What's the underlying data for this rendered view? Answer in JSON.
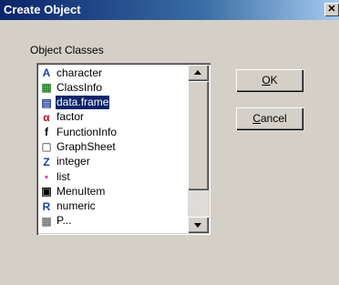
{
  "window": {
    "title": "Create Object",
    "close_glyph": "✕"
  },
  "group_label": "Object Classes",
  "list": {
    "items": [
      {
        "label": "character",
        "icon": "character-a-icon",
        "glyph": "A",
        "color": "#1f3fa0",
        "bg": "#ffffff"
      },
      {
        "label": "ClassInfo",
        "icon": "classinfo-icon",
        "glyph": "▦",
        "color": "#2e8b2e",
        "bg": "#ffffff"
      },
      {
        "label": "data.frame",
        "icon": "data-frame-icon",
        "glyph": "▤",
        "color": "#1f3fa0",
        "bg": "#ffffff",
        "selected": true
      },
      {
        "label": "factor",
        "icon": "factor-icon",
        "glyph": "α",
        "color": "#c01010",
        "bg": "#ffffff"
      },
      {
        "label": "FunctionInfo",
        "icon": "functioninfo-icon",
        "glyph": "f",
        "color": "#000000",
        "bg": "#ffffff"
      },
      {
        "label": "GraphSheet",
        "icon": "graphsheet-icon",
        "glyph": "▢",
        "color": "#808080",
        "bg": "#ffffff"
      },
      {
        "label": "integer",
        "icon": "integer-z-icon",
        "glyph": "Z",
        "color": "#1f3fa0",
        "bg": "#ffffff"
      },
      {
        "label": "list",
        "icon": "list-icon",
        "glyph": "▪",
        "color": "#d040d0",
        "bg": "#ffffff"
      },
      {
        "label": "MenuItem",
        "icon": "menuitem-icon",
        "glyph": "▣",
        "color": "#000000",
        "bg": "#ffffff"
      },
      {
        "label": "numeric",
        "icon": "numeric-r-icon",
        "glyph": "R",
        "color": "#1f3fa0",
        "bg": "#ffffff"
      },
      {
        "label": "P...",
        "icon": "partial-item-icon",
        "glyph": "▦",
        "color": "#808080",
        "bg": "#ffffff"
      }
    ]
  },
  "buttons": {
    "ok": {
      "mnemonic": "O",
      "rest": "K"
    },
    "cancel": {
      "mnemonic": "C",
      "rest": "ancel"
    }
  }
}
